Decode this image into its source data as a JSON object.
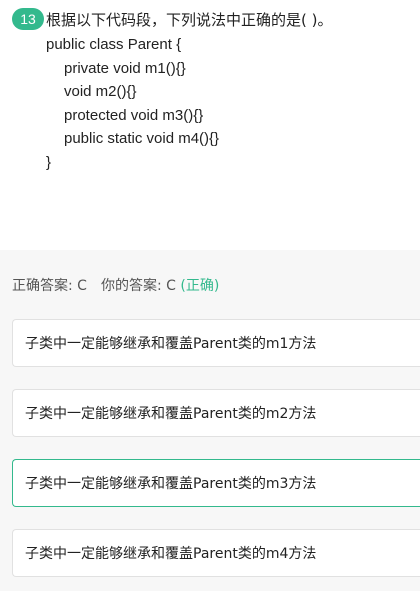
{
  "question": {
    "number": "13",
    "text": "根据以下代码段，下列说法中正确的是(    )。",
    "code": [
      "public class Parent {",
      "private void m1(){}",
      "void m2(){}",
      "protected void m3(){}",
      "public static void m4(){}",
      "}"
    ]
  },
  "result": {
    "correct_label": "正确答案: C",
    "your_label": "你的答案: C",
    "status": "(正确)"
  },
  "options": [
    "子类中一定能够继承和覆盖Parent类的m1方法",
    "子类中一定能够继承和覆盖Parent类的m2方法",
    "子类中一定能够继承和覆盖Parent类的m3方法",
    "子类中一定能够继承和覆盖Parent类的m4方法"
  ],
  "colors": {
    "accent": "#33b98d"
  }
}
